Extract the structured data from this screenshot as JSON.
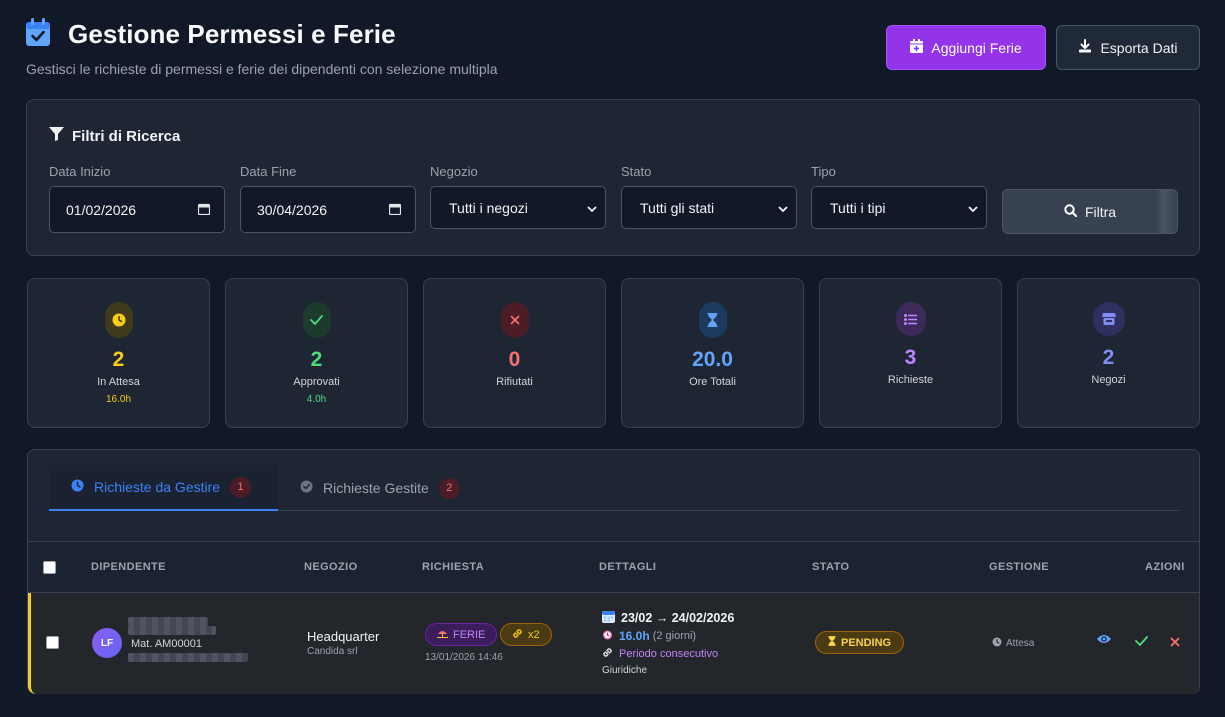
{
  "header": {
    "title": "Gestione Permessi e Ferie",
    "subtitle": "Gestisci le richieste di permessi e ferie dei dipendenti con selezione multipla",
    "add_button": "Aggiungi Ferie",
    "export_button": "Esporta Dati"
  },
  "filters": {
    "title": "Filtri di Ricerca",
    "start_label": "Data Inizio",
    "start_value": "01/02/2026",
    "end_label": "Data Fine",
    "end_value": "30/04/2026",
    "store_label": "Negozio",
    "store_value": "Tutti i negozi",
    "status_label": "Stato",
    "status_value": "Tutti gli stati",
    "type_label": "Tipo",
    "type_value": "Tutti i tipi",
    "filter_button": "Filtra"
  },
  "stats": [
    {
      "value": "2",
      "label": "In Attesa",
      "sub": "16.0h",
      "icon": "clock-icon",
      "color": "#facc15"
    },
    {
      "value": "2",
      "label": "Approvati",
      "sub": "4.0h",
      "icon": "check-icon",
      "color": "#4ade80"
    },
    {
      "value": "0",
      "label": "Rifiutati",
      "sub": "",
      "icon": "x-icon",
      "color": "#f87171"
    },
    {
      "value": "20.0",
      "label": "Ore Totali",
      "sub": "",
      "icon": "hourglass-icon",
      "color": "#60a5fa"
    },
    {
      "value": "3",
      "label": "Richieste",
      "sub": "",
      "icon": "list-icon",
      "color": "#c084fc"
    },
    {
      "value": "2",
      "label": "Negozi",
      "sub": "",
      "icon": "store-icon",
      "color": "#818cf8"
    }
  ],
  "tabs": [
    {
      "label": "Richieste da Gestire",
      "count": "1"
    },
    {
      "label": "Richieste Gestite",
      "count": "2"
    }
  ],
  "table": {
    "columns": [
      "DIPENDENTE",
      "NEGOZIO",
      "RICHIESTA",
      "DETTAGLI",
      "STATO",
      "GESTIONE",
      "AZIONI"
    ],
    "rows": [
      {
        "initials": "LF",
        "matricola": "Mat. AM00001",
        "store": "Headquarter",
        "company": "Candida srl",
        "type": "FERIE",
        "multiplier": "x2",
        "created": "13/01/2026 14:46",
        "period": "23/02 → 24/02/2026",
        "hours": "16.0h",
        "days": "(2 giorni)",
        "consecutive": "Periodo consecutivo",
        "category": "Giuridiche",
        "status": "PENDING",
        "management": "Attesa"
      }
    ]
  },
  "colors": {
    "accent": "#9333ea",
    "tab_active": "#3b82f6",
    "pending": "#facc15"
  }
}
